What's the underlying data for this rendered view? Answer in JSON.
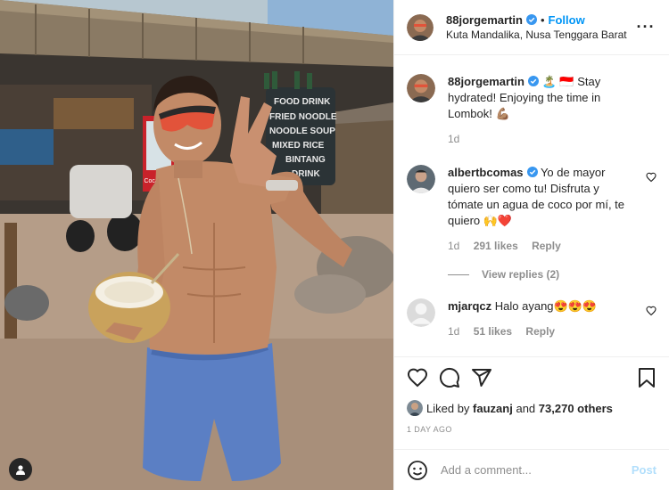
{
  "post": {
    "username": "88jorgemartin",
    "dot": "•",
    "follow_label": "Follow",
    "location": "Kuta Mandalika, Nusa Tenggara Barat",
    "more_icon": "more-horizontal-icon",
    "photo_text": {
      "sign": [
        "FOOD DRINK",
        "FRIED NOODLE",
        "NOODLE SOUP",
        "MIXED RICE",
        "BINTANG",
        "DRINK"
      ],
      "fridge": "Coca-Cola"
    }
  },
  "caption": {
    "username": "88jorgemartin",
    "text": "🏝️ 🇮🇩 Stay hydrated! Enjoying the time in Lombok! 💪🏽",
    "age": "1d"
  },
  "comments": [
    {
      "username": "albertbcomas",
      "verified": true,
      "text": "Yo de mayor quiero ser como tu! Disfruta y tómate un agua de coco por mí, te quiero 🙌❤️",
      "age": "1d",
      "likes": "291 likes",
      "reply": "Reply",
      "view_replies": "View replies (2)"
    },
    {
      "username": "mjarqcz",
      "verified": false,
      "text": "Halo ayang😍😍😍",
      "age": "1d",
      "likes": "51 likes",
      "reply": "Reply"
    }
  ],
  "actions": {
    "liked_prefix": "Liked by",
    "liked_user": "fauzanj",
    "liked_and": "and",
    "liked_count": "73,270 others",
    "time_ago": "1 DAY AGO"
  },
  "composer": {
    "placeholder": "Add a comment...",
    "post_label": "Post"
  },
  "colors": {
    "accent": "#0095f6",
    "verified": "#3897f0",
    "heart_red": "#ed4956",
    "post_disabled": "#b2dffc"
  }
}
